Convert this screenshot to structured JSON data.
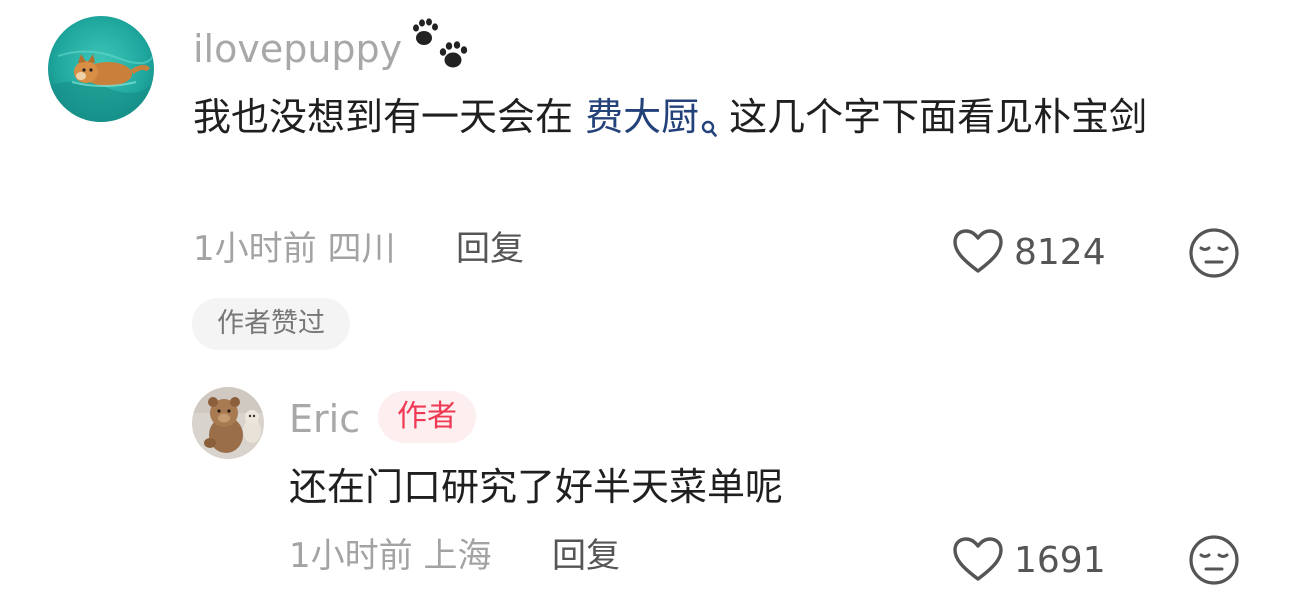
{
  "comment": {
    "username": "ilovepuppy",
    "username_icon": "paw-icon",
    "text_before_mention": "我也没想到有一天会在 ",
    "mention": "费大厨",
    "mention_icon": "search-icon",
    "text_after_mention": "这几个字下面看见朴宝剑",
    "time": "1小时前",
    "location": "四川",
    "reply_label": "回复",
    "like_count": "8124",
    "tag": "作者赞过"
  },
  "reply": {
    "username": "Eric",
    "badge": "作者",
    "text": "还在门口研究了好半天菜单呢",
    "time": "1小时前",
    "location": "上海",
    "reply_label": "回复",
    "like_count": "1691"
  },
  "colors": {
    "mention": "#24427a",
    "badge_text": "#f03a55",
    "badge_bg": "#fdeef0",
    "muted": "#a3a3a3"
  }
}
